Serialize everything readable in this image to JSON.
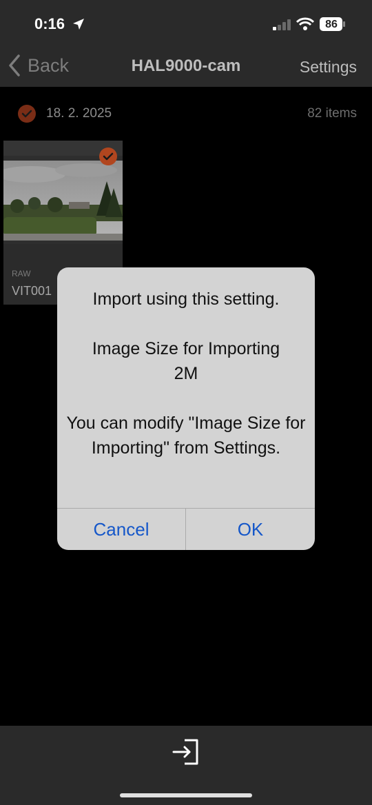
{
  "status": {
    "time": "0:16",
    "battery": "86"
  },
  "nav": {
    "back_label": "Back",
    "title": "HAL9000-cam",
    "settings_label": "Settings"
  },
  "group": {
    "date": "18. 2. 2025",
    "count": "82 items"
  },
  "thumbnail": {
    "format": "RAW",
    "filename": "VIT001"
  },
  "dialog": {
    "line1": "Import using this setting.",
    "line2": "Image Size for Importing",
    "line3": "2M",
    "line4": "You can modify \"Image Size for Importing\" from Settings.",
    "cancel_label": "Cancel",
    "ok_label": "OK"
  },
  "icons": {
    "location": "location-arrow-icon",
    "signal": "signal-icon",
    "wifi": "wifi-icon",
    "battery": "battery-icon",
    "back": "chevron-left-icon",
    "check": "check-icon",
    "import": "import-icon"
  },
  "colors": {
    "accent": "#b1461f",
    "link": "#1557c9",
    "dialog_bg": "#d3d3d3"
  }
}
